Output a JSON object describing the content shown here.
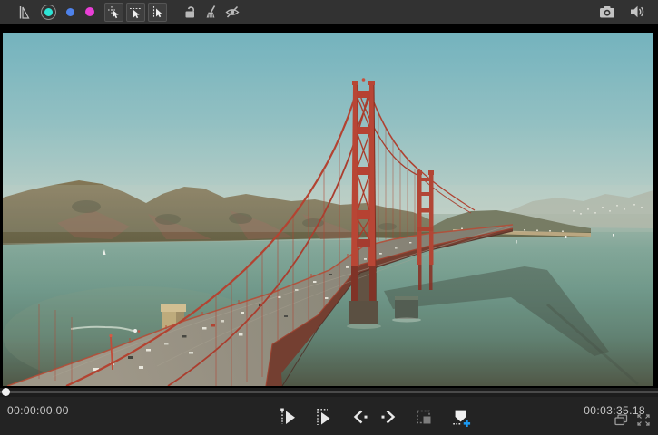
{
  "toolbar": {
    "tools": [
      {
        "name": "flip-tool"
      },
      {
        "name": "marker-cyan",
        "color": "#2ee4d6",
        "selected": true
      },
      {
        "name": "marker-blue",
        "color": "#4e82ea",
        "selected": false
      },
      {
        "name": "marker-magenta",
        "color": "#e93fd6",
        "selected": false
      },
      {
        "name": "select-marked-moment-tool"
      },
      {
        "name": "select-range-top-tool"
      },
      {
        "name": "select-range-side-tool"
      },
      {
        "name": "lock-open-tool"
      },
      {
        "name": "clear-markers-tool"
      },
      {
        "name": "hide-markers-tool"
      }
    ],
    "right_icons": [
      "snapshot-camera",
      "audio-volume"
    ]
  },
  "preview": {
    "scene": "golden-gate-bridge-aerial-video-frame"
  },
  "scrubber": {
    "position_fraction": 0
  },
  "transport": {
    "current_time": "00:00:00.00",
    "duration": "00:03:35.18",
    "buttons": [
      "play-from-in",
      "play-in-to-out",
      "previous-frame",
      "next-frame",
      "grab-frame",
      "add-marker"
    ],
    "add_marker_accent": "#1b9af2"
  },
  "corner_controls": [
    "stacked-monitor",
    "fullscreen-expand"
  ]
}
